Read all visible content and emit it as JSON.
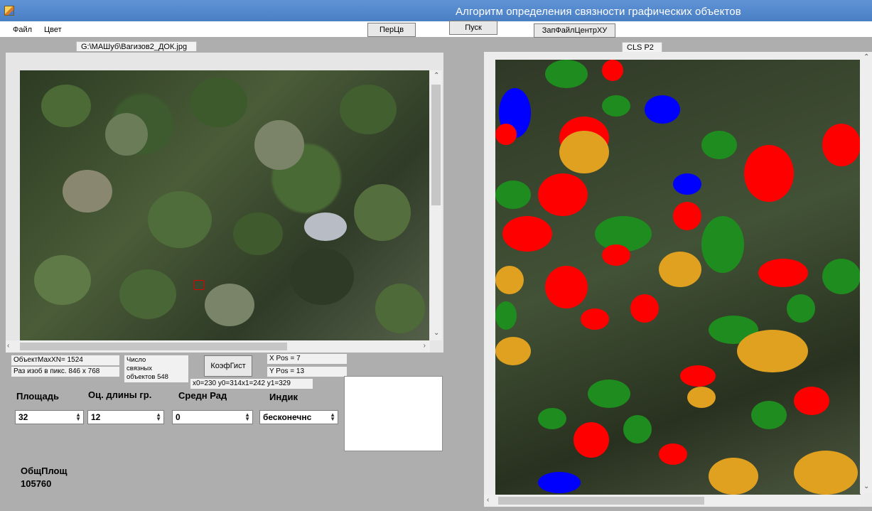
{
  "window": {
    "title": "Алгоритм определения связности графических объектов"
  },
  "menu": {
    "file": "Файл",
    "color": "Цвет"
  },
  "toolbar": {
    "perc_button": "ПерЦв",
    "run_button": "Пуск",
    "save_button": "ЗапФайлЦентрХУ"
  },
  "tabs": {
    "left_image": "G:\\МАШуб\\Вагизов2_ДОК.jpg",
    "right_image": "CLS  P2"
  },
  "stats": {
    "object_max": "ОбъектМахХN= 1524",
    "image_size": "Раз изоб в пикс. 846 x 768",
    "connected_label_1": "Число",
    "connected_label_2": "связных",
    "connected_label_3": "объектов",
    "connected_value": "548",
    "coef_button": "КоэфГист",
    "x_pos": "X Pos = 7",
    "y_pos": "Y Pos = 13",
    "coords": "x0=230 y0=314x1=242 y1=329"
  },
  "params": {
    "area_label": "Площадь",
    "area_value": "32",
    "border_label": "Оц. длины гр.",
    "border_value": "12",
    "radius_label": "Средн Рад",
    "radius_value": "0",
    "indicator_label": "Индик",
    "indicator_value": "бесконечнс"
  },
  "total": {
    "label": "ОбщПлощ",
    "value": "105760"
  },
  "colors": {
    "title_bar": "#4b7fc4",
    "red": "#ff0000",
    "green": "#1e8c1e",
    "blue": "#0000ff",
    "gold": "#e0a020"
  },
  "icons": {
    "spin": "spin-updown-icon",
    "scroll_up": "scroll-up-icon",
    "scroll_down": "scroll-down-icon",
    "scroll_left": "scroll-left-icon",
    "scroll_right": "scroll-right-icon"
  }
}
